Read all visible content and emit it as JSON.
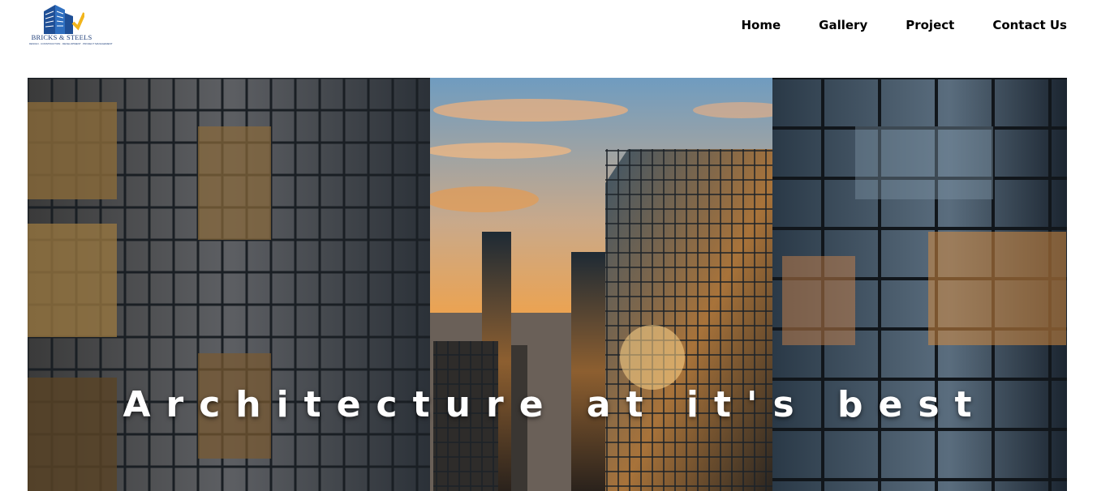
{
  "brand": {
    "name": "BRICKS & STEELS",
    "tagline": "DESIGN · CONSTRUCTION · DEVELOPMENT · PROJECT MANAGEMENT",
    "logo_icon": "building-logo-icon",
    "colors": {
      "primary": "#1f4f96",
      "accent": "#f2b51c"
    }
  },
  "nav": {
    "items": [
      {
        "label": "Home"
      },
      {
        "label": "Gallery"
      },
      {
        "label": "Project"
      },
      {
        "label": "Contact Us"
      }
    ]
  },
  "hero": {
    "title": "Architecture at it's best",
    "image": "city-skyscrapers-sunset"
  }
}
